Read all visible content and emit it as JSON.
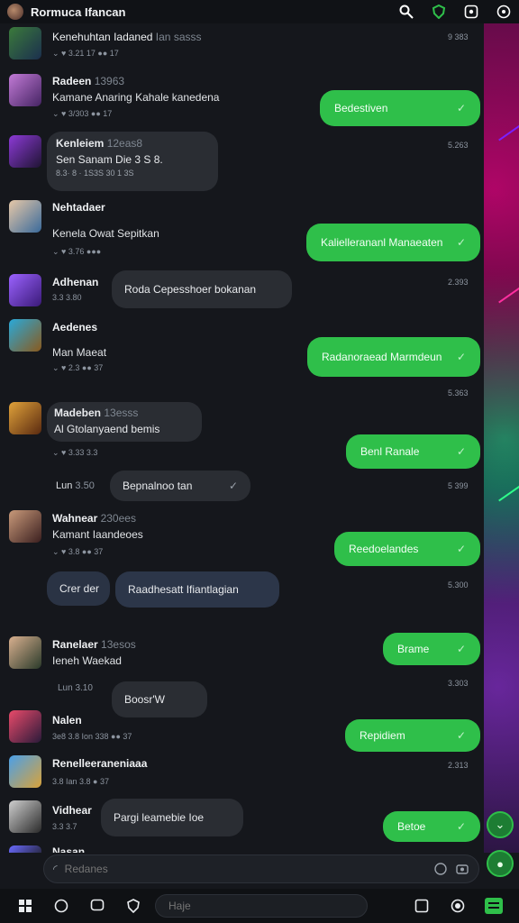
{
  "app": {
    "title": "Rormuca Ifancan"
  },
  "colors": {
    "accent": "#2fbf4a",
    "background": "#15171c",
    "incoming_bubble": "#2a2d33"
  },
  "top_icons": [
    "search-icon",
    "shield-icon",
    "network-icon",
    "settings-icon"
  ],
  "messages": [
    {
      "name": "Kenehuhtan Iadaned",
      "name_suffix": "Ian sasss",
      "meta": "⌄ ♥ 3.21 17 ●● 17",
      "time": "9 383"
    },
    {
      "name": "Radeen",
      "name_suffix": "13963",
      "text": "Kamane Anaring Kahale kanedena",
      "meta": "⌄ ♥ 3/303 ●● 17"
    },
    {
      "name": "Kenleiem",
      "name_suffix": "12eas8",
      "bubble_line1": "Sen Sanam Die 3 S 8.",
      "bubble_line2": "8.3· 8 · 1S3S 30 1 3S"
    },
    {
      "name": "Nehtadaer",
      "name_suffix": "",
      "text": "Kenela Owat Sepitkan",
      "meta": "⌄ ♥ 3.76 ●●●"
    },
    {
      "name": "Adhenan",
      "name_suffix": "",
      "meta": "3.3 3.80",
      "bubble": "Roda Cepesshoer bokanan",
      "time": "2.393"
    },
    {
      "name": "Aedenes",
      "name_suffix": "",
      "text": "Man Maeat",
      "meta": "⌄ ♥ 2.3 ●● 37",
      "time": "5.363"
    },
    {
      "name": "Madeben",
      "name_suffix": "13esss",
      "bubble": "Al Gtolanyaend bemis",
      "meta": "⌄ ♥ 3.33 3.3"
    },
    {
      "name": "Lun",
      "name_suffix": "3.50",
      "bubble": "Bepnalnoo tan",
      "time": "5 399"
    },
    {
      "name": "Wahnear",
      "name_suffix": "230ees",
      "text": "Kamant Iaandeoes",
      "meta": "⌄ ♥ 3.8 ●● 37"
    },
    {
      "name": "Crer der",
      "bubble": "Raadhesatt Ifiantlagian",
      "time": "5.300"
    },
    {
      "name": "Ranelaer",
      "name_suffix": "13esos",
      "text": "Ieneh Waekad",
      "meta": "Lun 3.10",
      "bubble": "Boosr'W",
      "time": "3.303"
    },
    {
      "name": "Nalen",
      "name_suffix": "",
      "meta": "3e8 3.8 Ion 338 ●● 37"
    },
    {
      "name": "Renelleeraneniaaa",
      "name_suffix": "",
      "meta": "3.8 Ian 3.8 ● 37",
      "time": "2.313"
    },
    {
      "name": "Vidhear",
      "name_suffix": "",
      "meta": "3.3 3.7",
      "bubble": "Pargi leamebie Ioe"
    },
    {
      "name": "Nasan",
      "name_suffix": ""
    }
  ],
  "outgoing": [
    {
      "text": "Bedestiven",
      "time": ""
    },
    {
      "text": "Kaliellerananl Manaeaten",
      "time": "5.263"
    },
    {
      "text": "Radanoraead Marmdeun",
      "time": ""
    },
    {
      "text": "Benl Ranale",
      "time": ""
    },
    {
      "text": "Reedoelandes",
      "time": ""
    },
    {
      "text": "Brame",
      "time": ""
    },
    {
      "text": "Repidiem",
      "time": ""
    },
    {
      "text": "Betoe",
      "time": ""
    }
  ],
  "compose": {
    "placeholder": "Redanes"
  },
  "bottom": {
    "search_placeholder": "Haje"
  }
}
